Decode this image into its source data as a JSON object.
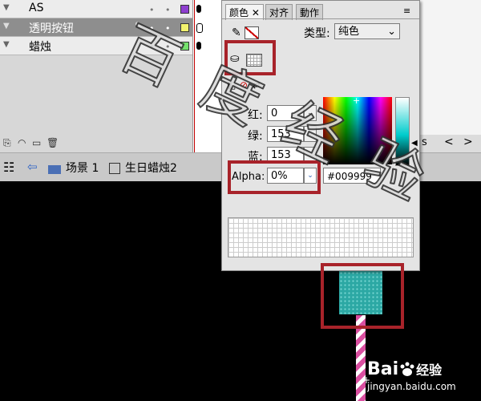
{
  "timeline": {
    "layers": [
      {
        "name": "AS",
        "color": "#8e3fcf",
        "selected": false
      },
      {
        "name": "透明按钮",
        "color": "#f2f26e",
        "selected": true
      },
      {
        "name": "蜡烛",
        "color": "#74e26c",
        "selected": false
      }
    ]
  },
  "scene_bar": {
    "scene_label": "场景 1",
    "symbol_label": "生日蜡烛2"
  },
  "color_panel": {
    "tabs": [
      "颜色",
      "对齐",
      "動作"
    ],
    "type_label": "类型:",
    "type_value": "纯色",
    "red_label": "红:",
    "red_value": "0",
    "green_label": "绿:",
    "green_value": "153",
    "blue_label": "蓝:",
    "blue_value": "153",
    "alpha_label": "Alpha:",
    "alpha_value": "0%",
    "hex_value": "#009999"
  },
  "frames_side_label": "s",
  "watermark_text": "百度经验",
  "baidu_brand": "Bai",
  "baidu_brand_cn": "经验",
  "baidu_url": "jingyan.baidu.com"
}
